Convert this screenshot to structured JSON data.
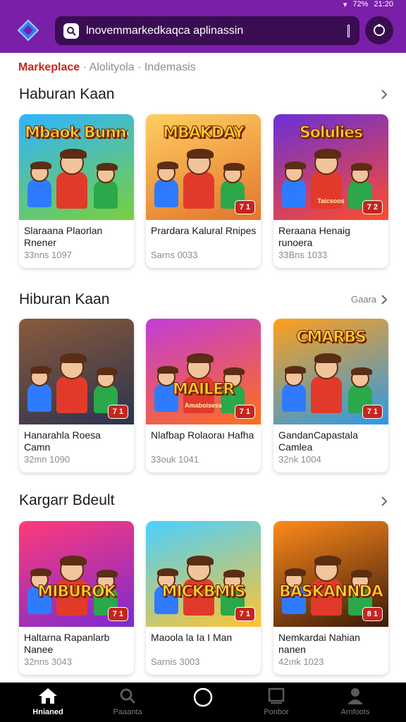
{
  "status_bar": {
    "time": "21:20",
    "battery": "72%"
  },
  "search": {
    "query": "lnovemmarkedkaqca aplinassin"
  },
  "breadcrumb": {
    "active": "Markeplace",
    "separator": "·",
    "rest": "Alolityola · Indemasis"
  },
  "sections": [
    {
      "title": "Haburan Kaan",
      "see_all": "",
      "cards": [
        {
          "art_text": "Mbaok Bunnois!",
          "art_sub": "",
          "badge": "",
          "title": "Slaraana Plaorlan Rnener",
          "meta": "33nns 1097",
          "bg_top": "#2fb4ff",
          "bg_bottom": "#79cf3e"
        },
        {
          "art_text": "MBAKDAY",
          "art_sub": "",
          "badge": "7 1",
          "title": "Prardara Kalural Rnipes",
          "meta": "Sarns 0033",
          "bg_top": "#ffce62",
          "bg_bottom": "#e2752b"
        },
        {
          "art_text": "Solulies",
          "art_sub": "Taicsoos",
          "badge": "7 2",
          "title": "Reraana Henaig runoera",
          "meta": "33Bns 1033",
          "bg_top": "#6a2fd8",
          "bg_bottom": "#ff4c2a"
        }
      ]
    },
    {
      "title": "Hiburan Kaan",
      "see_all": "Gaara",
      "cards": [
        {
          "art_text": "",
          "art_sub": "",
          "badge": "7 1",
          "title": "Hanarahla Roesa Camn",
          "meta": "32mn 1090",
          "bg_top": "#8a5a3a",
          "bg_bottom": "#2b3350"
        },
        {
          "art_text": "MAILER",
          "art_sub": "Amaboisess",
          "badge": "7 1",
          "title": "Nlafbap Rolaoraı Hafha",
          "meta": "33ouk 1041",
          "bg_top": "#c33cd8",
          "bg_bottom": "#ff6f1a"
        },
        {
          "art_text": "CMARBS",
          "art_sub": "",
          "badge": "7 1",
          "title": "GandanCapastala Camlea",
          "meta": "32nk 1004",
          "bg_top": "#ff9f1a",
          "bg_bottom": "#2a9ae8"
        }
      ]
    },
    {
      "title": "Kargarr Bdeult",
      "see_all": "",
      "cards": [
        {
          "art_text": "MIBUROK",
          "art_sub": "",
          "badge": "7 1",
          "title": "Haltarna Rapanlarb Nanee",
          "meta": "32nns 3043",
          "bg_top": "#ff3a7a",
          "bg_bottom": "#7c2bd0"
        },
        {
          "art_text": "MICKBMIS",
          "art_sub": "",
          "badge": "7 1",
          "title": "Maoola la Ia I Man",
          "meta": "Sarnis 3003",
          "bg_top": "#4ad0ff",
          "bg_bottom": "#ffc431"
        },
        {
          "art_text": "BASKANNDAS",
          "art_sub": "",
          "badge": "8 1",
          "title": "Nemkardai Nahian nanen",
          "meta": "42ınk 1023",
          "bg_top": "#ff8a1a",
          "bg_bottom": "#3a1a0a"
        }
      ]
    }
  ],
  "bottom_nav": [
    {
      "label": "Hnianed",
      "icon": "home-icon",
      "active": true
    },
    {
      "label": "Paaanta",
      "icon": "search-icon",
      "active": false
    },
    {
      "label": "",
      "icon": "circle-home-icon",
      "active": false
    },
    {
      "label": "Ponbor",
      "icon": "square-icon",
      "active": false
    },
    {
      "label": "Arnfoots",
      "icon": "profile-icon",
      "active": false
    }
  ],
  "colors": {
    "topbar": "#7a1fa8",
    "search_bg": "#3a0d52",
    "accent_red": "#c4261f"
  }
}
